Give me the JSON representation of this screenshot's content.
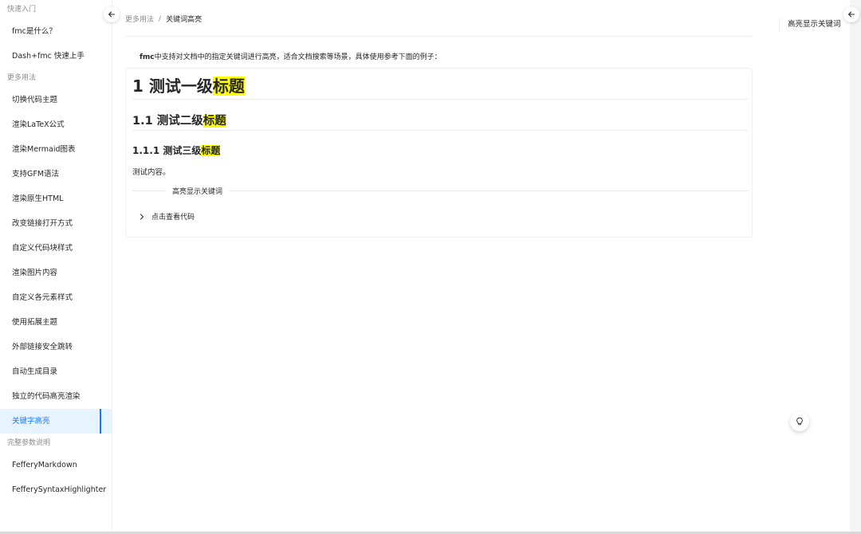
{
  "sidebar": {
    "groups": [
      {
        "title": "快速入门",
        "items": [
          "fmc是什么？",
          "Dash+fmc 快速上手"
        ]
      },
      {
        "title": "更多用法",
        "items": [
          "切换代码主题",
          "渲染LaTeX公式",
          "渲染Mermaid图表",
          "支持GFM语法",
          "渲染原生HTML",
          "改变链接打开方式",
          "自定义代码块样式",
          "渲染图片内容",
          "自定义各元素样式",
          "使用拓展主题",
          "外部链接安全跳转",
          "自动生成目录",
          "独立的代码高亮渲染",
          "关键字高亮"
        ]
      },
      {
        "title": "完整参数说明",
        "items": [
          "FefferyMarkdown",
          "FefferySyntaxHighlighter"
        ]
      }
    ],
    "active_item": "关键字高亮"
  },
  "breadcrumb": {
    "parent": "更多用法",
    "separator": "/",
    "current": "关键词高亮"
  },
  "content": {
    "intro_bold": "fmc",
    "intro_rest": "中支持对文档中的指定关键词进行高亮，适合文档搜索等场景，具体使用参考下面的例子：",
    "h1_prefix": "1 测试一级",
    "h2_prefix": "1.1 测试二级",
    "h3_prefix": "1.1.1 测试三级",
    "highlight_keyword": "标题",
    "paragraph": "测试内容。",
    "divider_text": "高亮显示关键词",
    "collapse_label": "点击查看代码"
  },
  "toc": {
    "item": "高亮显示关键词"
  },
  "icons": {
    "left_toggle": "arrow-left-icon",
    "right_toggle": "arrow-left-icon",
    "collapse": "chevron-right-icon",
    "float": "bulb-icon"
  },
  "colors": {
    "accent": "#1677ff",
    "highlight": "#ffff00",
    "active_bg": "#e6f4ff"
  }
}
